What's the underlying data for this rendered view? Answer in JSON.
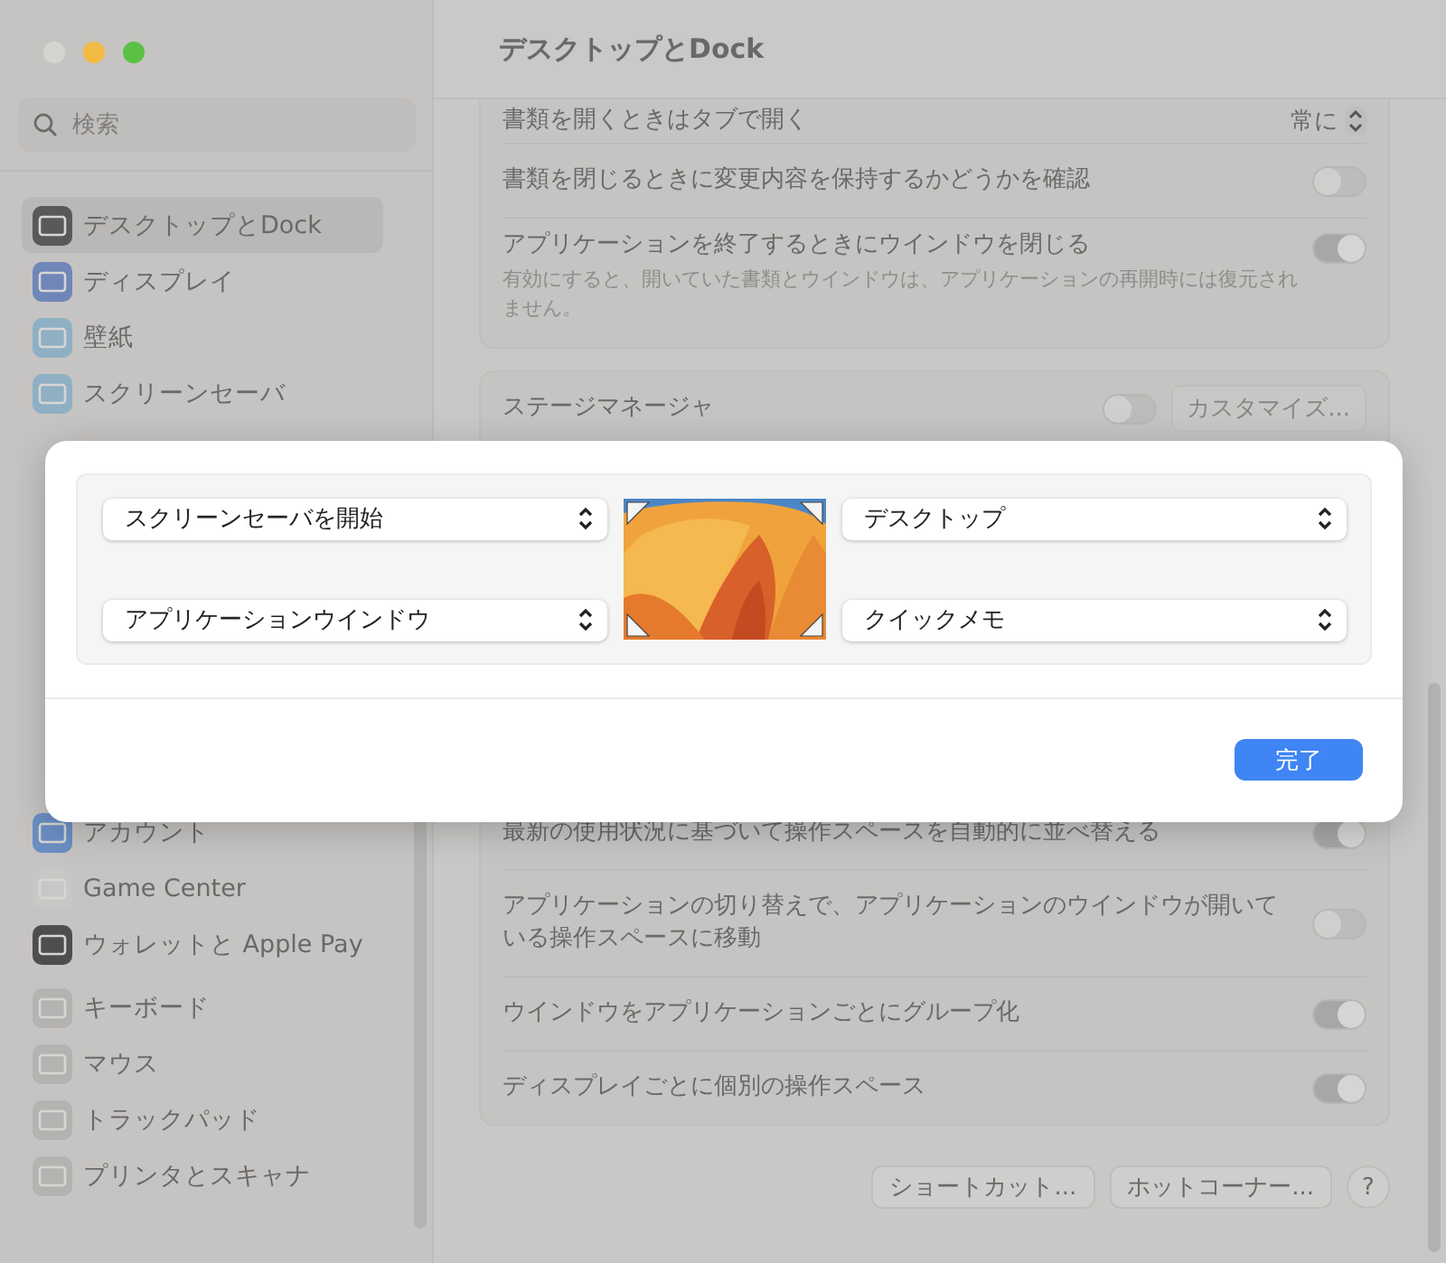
{
  "window": {
    "title": "デスクトップとDock"
  },
  "sidebar": {
    "search": {
      "placeholder": "検索"
    },
    "groups": [
      {
        "items": [
          {
            "label": "デスクトップとDock",
            "selected": true
          },
          {
            "label": "ディスプレイ",
            "selected": false
          },
          {
            "label": "壁紙",
            "selected": false
          },
          {
            "label": "スクリーンセーバ",
            "selected": false
          }
        ]
      },
      {
        "items": [
          {
            "label": "アカウント",
            "selected": false
          },
          {
            "label": "Game Center",
            "selected": false
          },
          {
            "label": "ウォレットと Apple Pay",
            "selected": false
          }
        ]
      },
      {
        "items": [
          {
            "label": "キーボード",
            "selected": false
          },
          {
            "label": "マウス",
            "selected": false
          },
          {
            "label": "トラックパッド",
            "selected": false
          },
          {
            "label": "プリンタとスキャナ",
            "selected": false
          }
        ]
      }
    ]
  },
  "cards": [
    {
      "rows": [
        {
          "kind": "popup",
          "label": "書類を開くときはタブで開く",
          "value": "常に"
        },
        {
          "kind": "toggle",
          "label": "書類を閉じるときに変更内容を保持するかどうかを確認",
          "on": false
        },
        {
          "kind": "toggle",
          "label": "アプリケーションを終了するときにウインドウを閉じる",
          "note": "有効にすると、開いていた書類とウインドウは、アプリケーションの再開時には復元されません。",
          "on": true
        }
      ]
    },
    {
      "rows": [
        {
          "kind": "toggle_button",
          "label": "ステージマネージャ",
          "on": false,
          "button": "カスタマイズ..."
        },
        {
          "kind": "hidden"
        },
        {
          "kind": "toggle",
          "label": "最新の使用状況に基づいて操作スペースを自動的に並べ替える",
          "on": true
        },
        {
          "kind": "toggle",
          "label": "アプリケーションの切り替えで、アプリケーションのウインドウが開いている操作スペースに移動",
          "on": false
        },
        {
          "kind": "toggle",
          "label": "ウインドウをアプリケーションごとにグループ化",
          "on": true
        },
        {
          "kind": "toggle",
          "label": "ディスプレイごとに個別の操作スペース",
          "on": true
        }
      ]
    }
  ],
  "footer_buttons": [
    "ショートカット...",
    "ホットコーナー...",
    "?"
  ],
  "sheet": {
    "corners": [
      {
        "value": "スクリーンセーバを開始"
      },
      {
        "value": "デスクトップ"
      },
      {
        "value": "アプリケーションウインドウ"
      },
      {
        "value": "クイックメモ"
      }
    ],
    "button": "完了"
  }
}
